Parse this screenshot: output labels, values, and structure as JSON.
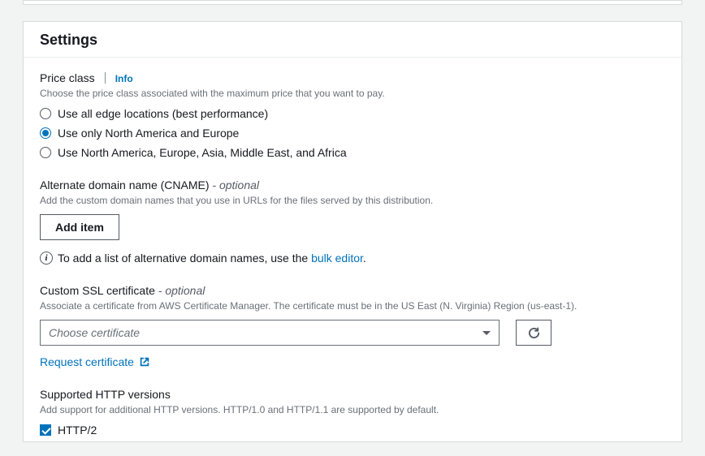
{
  "header": {
    "title": "Settings"
  },
  "priceClass": {
    "label": "Price class",
    "infoLabel": "Info",
    "hint": "Choose the price class associated with the maximum price that you want to pay.",
    "options": {
      "all": "Use all edge locations (best performance)",
      "na_eu": "Use only North America and Europe",
      "na_eu_asia": "Use North America, Europe, Asia, Middle East, and Africa"
    },
    "selected": "na_eu"
  },
  "cname": {
    "label": "Alternate domain name (CNAME)",
    "optional": "- optional",
    "hint": "Add the custom domain names that you use in URLs for the files served by this distribution.",
    "addButton": "Add item",
    "infoPrefix": "To add a list of alternative domain names, use the ",
    "bulkEditor": "bulk editor",
    "period": "."
  },
  "ssl": {
    "label": "Custom SSL certificate",
    "optional": "- optional",
    "hint": "Associate a certificate from AWS Certificate Manager. The certificate must be in the US East (N. Virginia) Region (us-east-1).",
    "placeholder": "Choose certificate",
    "requestLink": "Request certificate"
  },
  "http": {
    "label": "Supported HTTP versions",
    "hint": "Add support for additional HTTP versions. HTTP/1.0 and HTTP/1.1 are supported by default.",
    "http2": "HTTP/2"
  }
}
